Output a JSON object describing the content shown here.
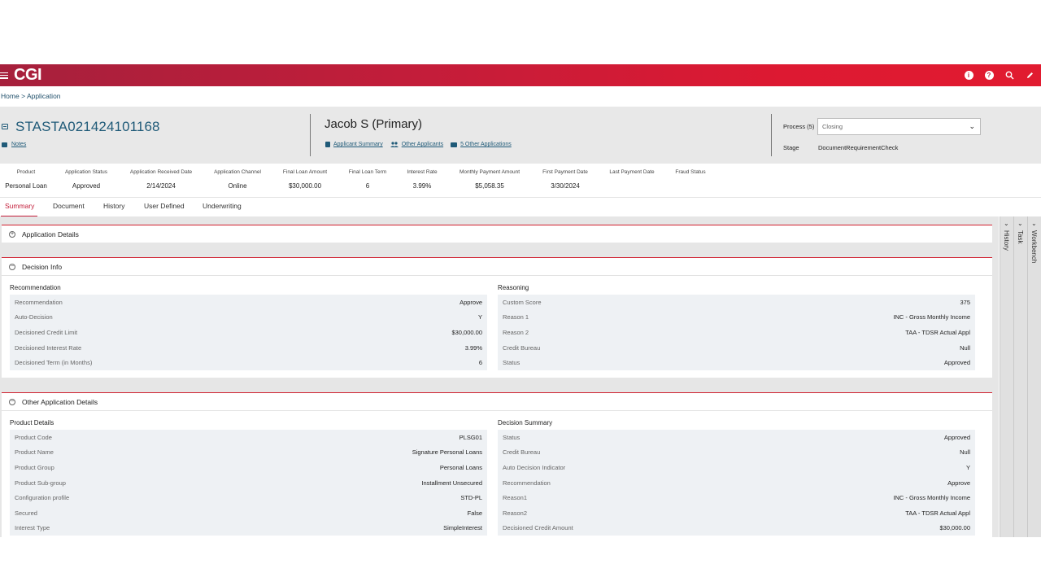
{
  "header": {
    "logo": "CGI",
    "icons": [
      "info-icon",
      "help-icon",
      "search-icon",
      "edit-icon"
    ]
  },
  "breadcrumb": {
    "home": "Home",
    "sep": ">",
    "current": "Application"
  },
  "application": {
    "id": "STASTA021424101168",
    "notes_label": "Notes",
    "applicant": "Jacob S (Primary)",
    "links": {
      "applicant_summary": "Applicant Summary",
      "other_applicants": "Other Applicants",
      "other_applications": "5 Other Applications"
    },
    "process_label": "Process (5)",
    "process_value": "Closing",
    "stage_label": "Stage",
    "stage_value": "DocumentRequirementCheck"
  },
  "summary": [
    {
      "label": "Product",
      "value": "Personal Loan"
    },
    {
      "label": "Application Status",
      "value": "Approved"
    },
    {
      "label": "Application Received Date",
      "value": "2/14/2024"
    },
    {
      "label": "Application Channel",
      "value": "Online"
    },
    {
      "label": "Final Loan Amount",
      "value": "$30,000.00"
    },
    {
      "label": "Final Loan Term",
      "value": "6"
    },
    {
      "label": "Interest Rate",
      "value": "3.99%"
    },
    {
      "label": "Monthly Payment Amount",
      "value": "$5,058.35"
    },
    {
      "label": "First Payment Date",
      "value": "3/30/2024"
    },
    {
      "label": "Last Payment Date",
      "value": ""
    },
    {
      "label": "Fraud Status",
      "value": ""
    }
  ],
  "tabs": [
    "Summary",
    "Document",
    "History",
    "User Defined",
    "Underwriting"
  ],
  "panels": {
    "application_details": {
      "title": "Application Details",
      "toggle": "+"
    },
    "decision_info": {
      "title": "Decision Info",
      "toggle": "−",
      "recommendation_title": "Recommendation",
      "recommendation": [
        {
          "k": "Recommendation",
          "v": "Approve"
        },
        {
          "k": "Auto-Decision",
          "v": "Y"
        },
        {
          "k": "Decisioned Credit Limit",
          "v": "$30,000.00"
        },
        {
          "k": "Decisioned Interest Rate",
          "v": "3.99%"
        },
        {
          "k": "Decisioned Term (in Months)",
          "v": "6"
        }
      ],
      "reasoning_title": "Reasoning",
      "reasoning": [
        {
          "k": "Custom Score",
          "v": "375"
        },
        {
          "k": "Reason 1",
          "v": "INC - Gross Monthly Income"
        },
        {
          "k": "Reason 2",
          "v": "TAA - TDSR Actual Appl"
        },
        {
          "k": "Credit Bureau",
          "v": "Null"
        },
        {
          "k": "Status",
          "v": "Approved"
        }
      ]
    },
    "other_details": {
      "title": "Other Application Details",
      "toggle": "−",
      "product_title": "Product Details",
      "product": [
        {
          "k": "Product Code",
          "v": "PLSG01"
        },
        {
          "k": "Product Name",
          "v": "Signature Personal Loans"
        },
        {
          "k": "Product Group",
          "v": "Personal Loans"
        },
        {
          "k": "Product Sub-group",
          "v": "Installment Unsecured"
        },
        {
          "k": "Configuration profile",
          "v": "STD-PL"
        },
        {
          "k": "Secured",
          "v": "False"
        },
        {
          "k": "Interest Type",
          "v": "SimpleInterest"
        }
      ],
      "decision_title": "Decision Summary",
      "decision": [
        {
          "k": "Status",
          "v": "Approved"
        },
        {
          "k": "Credit Bureau",
          "v": "Null"
        },
        {
          "k": "Auto Decision Indicator",
          "v": "Y"
        },
        {
          "k": "Recommendation",
          "v": "Approve"
        },
        {
          "k": "Reason1",
          "v": "INC - Gross Monthly Income"
        },
        {
          "k": "Reason2",
          "v": "TAA - TDSR Actual Appl"
        },
        {
          "k": "Decisioned Credit Amount",
          "v": "$30,000.00"
        }
      ]
    }
  },
  "side_tabs": [
    "History",
    "Task",
    "Workbench"
  ]
}
